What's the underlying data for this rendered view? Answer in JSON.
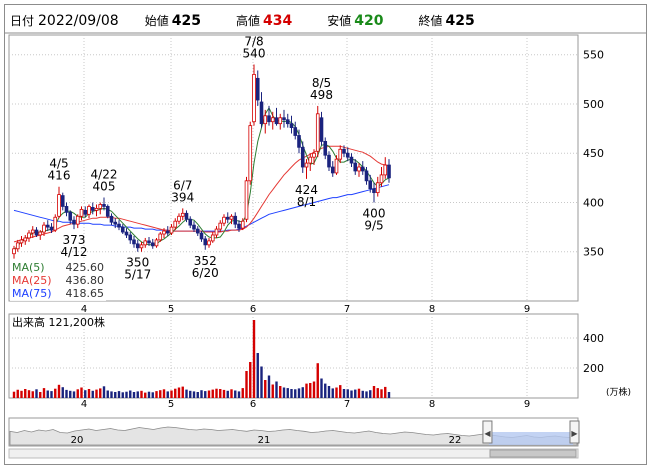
{
  "header": {
    "date_label": "日付",
    "date": "2022/09/08",
    "open_label": "始値",
    "open": "425",
    "high_label": "高値",
    "high": "434",
    "low_label": "安値",
    "low": "420",
    "close_label": "終値",
    "close": "425"
  },
  "colors": {
    "up": "#d40000",
    "down": "#1a237e",
    "ma5": "#2e7d32",
    "ma25": "#e53935",
    "ma75": "#1e40ff",
    "high_text": "#d40000",
    "low_text": "#1a8a1a",
    "grid": "#c8c8c8"
  },
  "legend": [
    {
      "label": "MA(5)",
      "value": "425.60"
    },
    {
      "label": "MA(25)",
      "value": "436.80"
    },
    {
      "label": "MA(75)",
      "value": "418.65"
    }
  ],
  "volume_label": "出来高",
  "volume_value": "121,200株",
  "volume_unit": "(万株)",
  "chart_data": [
    {
      "type": "candlestick",
      "title": "",
      "x_ticks": [
        "4",
        "5",
        "6",
        "7",
        "8",
        "9"
      ],
      "y_ticks": [
        350,
        400,
        450,
        500,
        550
      ],
      "ylim": [
        300,
        570
      ],
      "grid": true,
      "candles": [
        [
          348,
          356,
          343,
          353
        ],
        [
          353,
          362,
          350,
          359
        ],
        [
          359,
          366,
          355,
          362
        ],
        [
          361,
          367,
          357,
          364
        ],
        [
          364,
          372,
          360,
          369
        ],
        [
          369,
          376,
          364,
          372
        ],
        [
          372,
          375,
          365,
          367
        ],
        [
          367,
          372,
          362,
          370
        ],
        [
          370,
          380,
          366,
          377
        ],
        [
          377,
          382,
          371,
          375
        ],
        [
          375,
          379,
          369,
          372
        ],
        [
          372,
          388,
          370,
          385
        ],
        [
          386,
          416,
          384,
          408
        ],
        [
          407,
          410,
          392,
          396
        ],
        [
          396,
          400,
          386,
          390
        ],
        [
          390,
          392,
          378,
          382
        ],
        [
          382,
          386,
          373,
          378
        ],
        [
          378,
          388,
          374,
          386
        ],
        [
          386,
          396,
          382,
          393
        ],
        [
          392,
          396,
          385,
          388
        ],
        [
          388,
          398,
          384,
          396
        ],
        [
          395,
          400,
          388,
          392
        ],
        [
          392,
          398,
          386,
          394
        ],
        [
          394,
          400,
          388,
          398
        ],
        [
          398,
          405,
          392,
          396
        ],
        [
          396,
          398,
          384,
          386
        ],
        [
          386,
          389,
          377,
          380
        ],
        [
          380,
          384,
          374,
          378
        ],
        [
          378,
          382,
          372,
          375
        ],
        [
          375,
          378,
          368,
          370
        ],
        [
          370,
          374,
          364,
          367
        ],
        [
          367,
          370,
          358,
          362
        ],
        [
          362,
          366,
          354,
          358
        ],
        [
          358,
          362,
          350,
          354
        ],
        [
          354,
          360,
          350,
          357
        ],
        [
          357,
          364,
          354,
          361
        ],
        [
          361,
          365,
          356,
          359
        ],
        [
          359,
          363,
          353,
          356
        ],
        [
          356,
          364,
          354,
          362
        ],
        [
          362,
          370,
          360,
          368
        ],
        [
          368,
          374,
          364,
          371
        ],
        [
          371,
          376,
          366,
          369
        ],
        [
          369,
          378,
          367,
          375
        ],
        [
          375,
          384,
          372,
          381
        ],
        [
          381,
          389,
          378,
          386
        ],
        [
          386,
          394,
          382,
          389
        ],
        [
          389,
          392,
          380,
          383
        ],
        [
          383,
          386,
          374,
          377
        ],
        [
          377,
          381,
          370,
          373
        ],
        [
          373,
          376,
          366,
          369
        ],
        [
          369,
          371,
          360,
          363
        ],
        [
          363,
          366,
          352,
          357
        ],
        [
          357,
          364,
          354,
          361
        ],
        [
          361,
          370,
          359,
          367
        ],
        [
          367,
          376,
          364,
          373
        ],
        [
          373,
          382,
          370,
          379
        ],
        [
          379,
          388,
          376,
          385
        ],
        [
          385,
          390,
          379,
          383
        ],
        [
          383,
          388,
          378,
          386
        ],
        [
          386,
          390,
          374,
          378
        ],
        [
          378,
          382,
          370,
          374
        ],
        [
          374,
          384,
          372,
          381
        ],
        [
          383,
          426,
          380,
          422
        ],
        [
          422,
          482,
          418,
          478
        ],
        [
          482,
          540,
          478,
          530
        ],
        [
          526,
          534,
          498,
          504
        ],
        [
          502,
          512,
          476,
          480
        ],
        [
          480,
          494,
          470,
          488
        ],
        [
          488,
          498,
          478,
          482
        ],
        [
          482,
          492,
          474,
          486
        ],
        [
          486,
          496,
          478,
          480
        ],
        [
          480,
          490,
          474,
          486
        ],
        [
          486,
          494,
          476,
          484
        ],
        [
          484,
          490,
          476,
          480
        ],
        [
          480,
          488,
          470,
          476
        ],
        [
          476,
          482,
          464,
          468
        ],
        [
          468,
          474,
          450,
          456
        ],
        [
          456,
          462,
          430,
          436
        ],
        [
          436,
          444,
          424,
          440
        ],
        [
          440,
          450,
          432,
          446
        ],
        [
          446,
          454,
          438,
          450
        ],
        [
          452,
          498,
          446,
          490
        ],
        [
          486,
          492,
          458,
          462
        ],
        [
          462,
          466,
          444,
          448
        ],
        [
          448,
          452,
          432,
          436
        ],
        [
          436,
          442,
          426,
          430
        ],
        [
          430,
          448,
          428,
          444
        ],
        [
          444,
          458,
          440,
          454
        ],
        [
          454,
          458,
          446,
          450
        ],
        [
          450,
          456,
          442,
          446
        ],
        [
          446,
          450,
          436,
          440
        ],
        [
          440,
          444,
          428,
          432
        ],
        [
          432,
          440,
          426,
          436
        ],
        [
          436,
          442,
          428,
          432
        ],
        [
          432,
          436,
          418,
          422
        ],
        [
          422,
          428,
          410,
          414
        ],
        [
          414,
          420,
          400,
          410
        ],
        [
          410,
          426,
          406,
          420
        ],
        [
          420,
          436,
          416,
          428
        ],
        [
          428,
          446,
          424,
          438
        ],
        [
          438,
          444,
          420,
          425
        ]
      ],
      "ma5": [
        352,
        356,
        360,
        363,
        366,
        369,
        370,
        370,
        371,
        372,
        373,
        377,
        385,
        389,
        391,
        391,
        389,
        386,
        385,
        385,
        389,
        391,
        392,
        393,
        394,
        393,
        391,
        387,
        383,
        379,
        375,
        371,
        367,
        363,
        360,
        358,
        357,
        357,
        358,
        361,
        363,
        366,
        369,
        373,
        376,
        380,
        383,
        383,
        382,
        378,
        373,
        368,
        365,
        364,
        364,
        365,
        370,
        377,
        381,
        382,
        381,
        380,
        388,
        410,
        440,
        462,
        476,
        490,
        496,
        488,
        483,
        483,
        482,
        483,
        481,
        477,
        469,
        458,
        448,
        439,
        440,
        448,
        458,
        459,
        457,
        452,
        445,
        441,
        441,
        443,
        444,
        443,
        440,
        436,
        432,
        426,
        420,
        416,
        419,
        423,
        425
      ],
      "ma25": [
        360,
        361,
        362,
        363,
        364,
        365,
        366,
        367,
        368,
        369,
        370,
        372,
        374,
        376,
        377,
        378,
        379,
        380,
        381,
        382,
        383,
        384,
        384,
        385,
        385,
        385,
        385,
        384,
        384,
        383,
        382,
        381,
        380,
        379,
        378,
        377,
        376,
        375,
        374,
        373,
        372,
        372,
        371,
        371,
        371,
        371,
        371,
        371,
        371,
        371,
        371,
        370,
        370,
        370,
        370,
        370,
        371,
        371,
        372,
        372,
        372,
        373,
        375,
        379,
        384,
        390,
        396,
        402,
        408,
        413,
        418,
        423,
        428,
        432,
        436,
        440,
        443,
        445,
        447,
        449,
        451,
        453,
        455,
        456,
        457,
        457,
        457,
        457,
        456,
        455,
        454,
        453,
        452,
        451,
        449,
        447,
        444,
        441,
        439,
        438,
        437
      ],
      "ma75": [
        392,
        391,
        390,
        389,
        388,
        387,
        386,
        385,
        384,
        383,
        382,
        381,
        381,
        380,
        380,
        380,
        380,
        379,
        379,
        379,
        379,
        378,
        378,
        378,
        377,
        377,
        377,
        376,
        376,
        375,
        375,
        375,
        374,
        374,
        374,
        373,
        373,
        373,
        372,
        372,
        372,
        372,
        371,
        371,
        371,
        371,
        371,
        371,
        371,
        371,
        371,
        371,
        371,
        371,
        371,
        371,
        371,
        372,
        372,
        372,
        373,
        374,
        376,
        378,
        380,
        382,
        384,
        386,
        388,
        389,
        390,
        391,
        392,
        393,
        394,
        395,
        396,
        397,
        398,
        399,
        400,
        401,
        402,
        403,
        404,
        405,
        405,
        406,
        407,
        408,
        408,
        409,
        410,
        411,
        412,
        413,
        414,
        415,
        416,
        417,
        418
      ],
      "annotations": [
        {
          "date": "4/5",
          "value": "416"
        },
        {
          "date": "4/12",
          "value": "373"
        },
        {
          "date": "4/22",
          "value": "405"
        },
        {
          "date": "5/17",
          "value": "350"
        },
        {
          "date": "6/7",
          "value": "394"
        },
        {
          "date": "6/20",
          "value": "352"
        },
        {
          "date": "7/8",
          "value": "540"
        },
        {
          "date": "8/1",
          "value": "424"
        },
        {
          "date": "8/5",
          "value": "498"
        },
        {
          "date": "9/5",
          "value": "400"
        }
      ]
    },
    {
      "type": "bar",
      "title": "",
      "y_ticks": [
        200,
        400
      ],
      "ylim": [
        0,
        560
      ],
      "values": [
        42,
        55,
        48,
        60,
        52,
        45,
        58,
        40,
        66,
        50,
        46,
        62,
        88,
        72,
        54,
        48,
        44,
        58,
        70,
        52,
        60,
        48,
        56,
        64,
        78,
        50,
        44,
        40,
        46,
        38,
        42,
        50,
        40,
        44,
        48,
        36,
        42,
        38,
        46,
        52,
        58,
        44,
        50,
        62,
        70,
        76,
        56,
        48,
        44,
        40,
        52,
        46,
        50,
        56,
        62,
        60,
        54,
        48,
        58,
        50,
        44,
        66,
        180,
        240,
        520,
        300,
        210,
        120,
        150,
        90,
        110,
        80,
        70,
        66,
        60,
        58,
        64,
        72,
        96,
        100,
        110,
        232,
        130,
        96,
        80,
        64,
        70,
        86,
        60,
        58,
        50,
        56,
        62,
        48,
        44,
        52,
        80,
        66,
        58,
        74,
        40
      ],
      "up": [
        true,
        true,
        true,
        true,
        true,
        true,
        false,
        true,
        true,
        false,
        false,
        true,
        true,
        false,
        false,
        false,
        false,
        true,
        true,
        false,
        true,
        false,
        true,
        true,
        false,
        false,
        false,
        false,
        false,
        false,
        false,
        false,
        false,
        false,
        true,
        true,
        false,
        false,
        true,
        true,
        true,
        false,
        true,
        true,
        true,
        true,
        false,
        false,
        false,
        false,
        false,
        false,
        true,
        true,
        true,
        true,
        true,
        false,
        true,
        false,
        false,
        true,
        true,
        true,
        true,
        false,
        false,
        true,
        false,
        true,
        false,
        true,
        false,
        false,
        false,
        false,
        false,
        false,
        true,
        true,
        true,
        true,
        false,
        false,
        false,
        false,
        true,
        true,
        false,
        false,
        false,
        false,
        true,
        false,
        false,
        false,
        true,
        true,
        true,
        true,
        false
      ]
    },
    {
      "type": "area",
      "title": "",
      "x_ticks": [
        "20",
        "21",
        "22"
      ],
      "values": [
        0.55,
        0.5,
        0.58,
        0.52,
        0.6,
        0.56,
        0.62,
        0.5,
        0.48,
        0.56,
        0.6,
        0.64,
        0.58,
        0.62,
        0.66,
        0.6,
        0.58,
        0.64,
        0.7,
        0.66,
        0.62,
        0.68,
        0.72,
        0.7,
        0.66,
        0.62,
        0.6,
        0.64,
        0.62,
        0.58,
        0.6,
        0.62,
        0.58,
        0.55,
        0.6,
        0.58,
        0.54,
        0.56,
        0.6,
        0.62,
        0.58,
        0.55,
        0.5,
        0.52,
        0.56,
        0.58,
        0.54,
        0.5,
        0.48,
        0.52,
        0.56,
        0.5,
        0.46,
        0.44,
        0.48,
        0.52,
        0.5,
        0.46,
        0.42,
        0.4,
        0.44,
        0.46,
        0.42,
        0.38,
        0.36,
        0.4,
        0.44,
        0.4,
        0.36,
        0.32,
        0.3,
        0.34,
        0.38,
        0.32,
        0.3,
        0.34,
        0.36,
        0.32,
        0.3,
        0.33
      ],
      "selected_fraction": [
        0.82,
        1.0
      ]
    }
  ]
}
